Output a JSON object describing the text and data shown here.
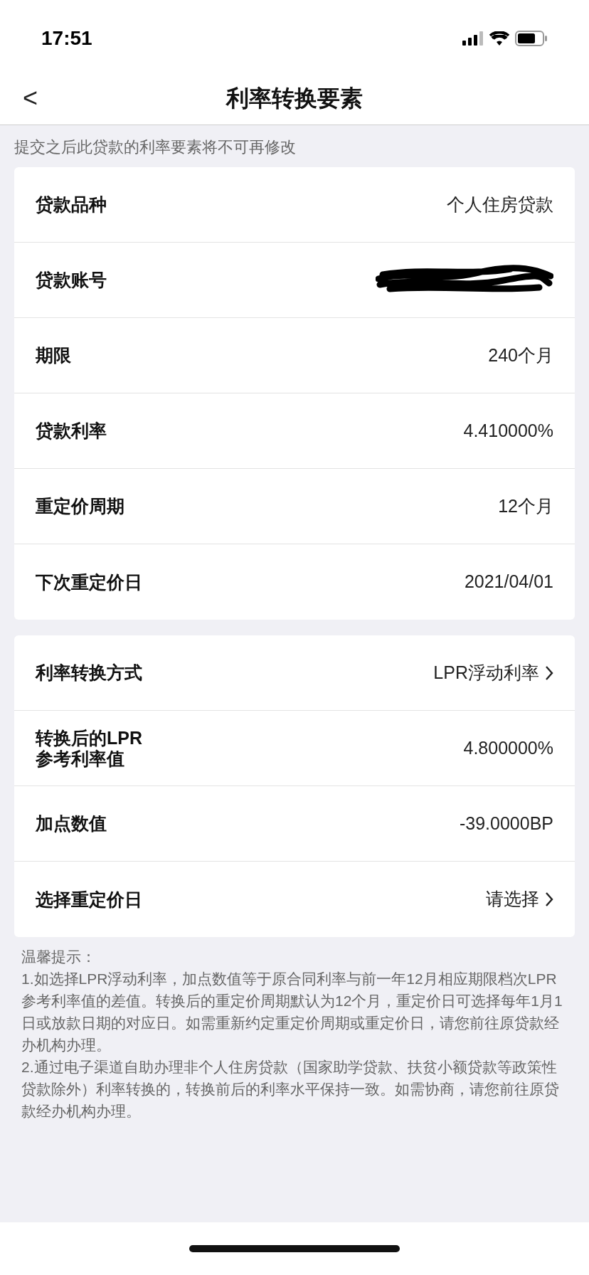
{
  "status_bar": {
    "time": "17:51"
  },
  "nav": {
    "back": "<",
    "title": "利率转换要素"
  },
  "notice": "提交之后此贷款的利率要素将不可再修改",
  "loan_rows": [
    {
      "kind": "text",
      "label": "贷款品种",
      "value": "个人住房贷款"
    },
    {
      "kind": "redacted",
      "label": "贷款账号"
    },
    {
      "kind": "text",
      "label": "期限",
      "value": "240个月"
    },
    {
      "kind": "text",
      "label": "贷款利率",
      "value": "4.410000%"
    },
    {
      "kind": "text",
      "label": "重定价周期",
      "value": "12个月"
    },
    {
      "kind": "text",
      "label": "下次重定价日",
      "value": "2021/04/01"
    }
  ],
  "conversion_rows": [
    {
      "kind": "select",
      "label": "利率转换方式",
      "value": "LPR浮动利率"
    },
    {
      "kind": "text",
      "label": "转换后的LPR\n参考利率值",
      "value": "4.800000%"
    },
    {
      "kind": "text",
      "label": "加点数值",
      "value": "-39.0000BP"
    },
    {
      "kind": "select",
      "label": "选择重定价日",
      "value": "请选择"
    }
  ],
  "tips": {
    "title": "温馨提示：",
    "items": [
      "1.如选择LPR浮动利率，加点数值等于原合同利率与前一年12月相应期限档次LPR参考利率值的差值。转换后的重定价周期默认为12个月，重定价日可选择每年1月1日或放款日期的对应日。如需重新约定重定价周期或重定价日，请您前往原贷款经办机构办理。",
      "2.通过电子渠道自助办理非个人住房贷款（国家助学贷款、扶贫小额贷款等政策性贷款除外）利率转换的，转换前后的利率水平保持一致。如需协商，请您前往原贷款经办机构办理。"
    ]
  }
}
